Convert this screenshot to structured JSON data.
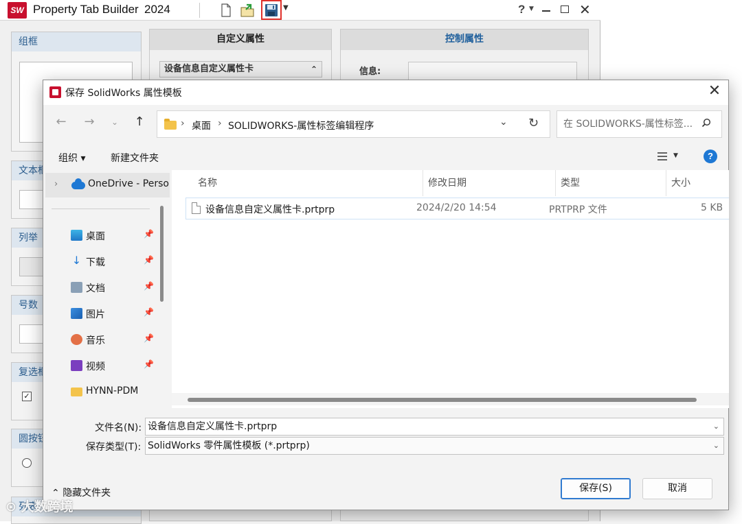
{
  "app": {
    "logo_text": "SW",
    "title": "Property Tab Builder",
    "version": "2024",
    "column_headers": [
      "自定义属性",
      "控制属性"
    ],
    "left_groups": [
      "组框",
      "文本框",
      "列举",
      "号数",
      "复选框",
      "圆按钮",
      "列表"
    ],
    "card_title": "设备信息自定义属性卡",
    "info_label": "信息:"
  },
  "dialog": {
    "title": "保存 SolidWorks 属性模板",
    "breadcrumb": [
      "桌面",
      "SOLIDWORKS-属性标签编辑程序"
    ],
    "search_placeholder": "在 SOLIDWORKS-属性标签...",
    "toolbar": {
      "organize": "组织 ▾",
      "new_folder": "新建文件夹"
    },
    "nav": {
      "onedrive": "OneDrive - Personal",
      "items": [
        {
          "label": "桌面",
          "icon": "desktop-icon",
          "pinned": true
        },
        {
          "label": "下载",
          "icon": "download-icon",
          "pinned": true
        },
        {
          "label": "文档",
          "icon": "document-icon",
          "pinned": true
        },
        {
          "label": "图片",
          "icon": "pictures-icon",
          "pinned": true
        },
        {
          "label": "音乐",
          "icon": "music-icon",
          "pinned": true
        },
        {
          "label": "视频",
          "icon": "video-icon",
          "pinned": true
        },
        {
          "label": "HYNN-PDM",
          "icon": "folder-icon",
          "pinned": false
        }
      ]
    },
    "columns": [
      "名称",
      "修改日期",
      "类型",
      "大小"
    ],
    "files": [
      {
        "name": "设备信息自定义属性卡.prtprp",
        "modified": "2024/2/20 14:54",
        "type": "PRTPRP 文件",
        "size": "5 KB"
      }
    ],
    "filename_label": "文件名(N):",
    "filename_value": "设备信息自定义属性卡.prtprp",
    "filetype_label": "保存类型(T):",
    "filetype_value": "SolidWorks 零件属性模板 (*.prtprp)",
    "hide_folders": "隐藏文件夹",
    "save_button": "保存(S)",
    "cancel_button": "取消"
  },
  "watermark": "大数跨境",
  "colors": {
    "accent": "#1e78d4",
    "brand": "#c8102e",
    "highlight": "#e0302b"
  }
}
